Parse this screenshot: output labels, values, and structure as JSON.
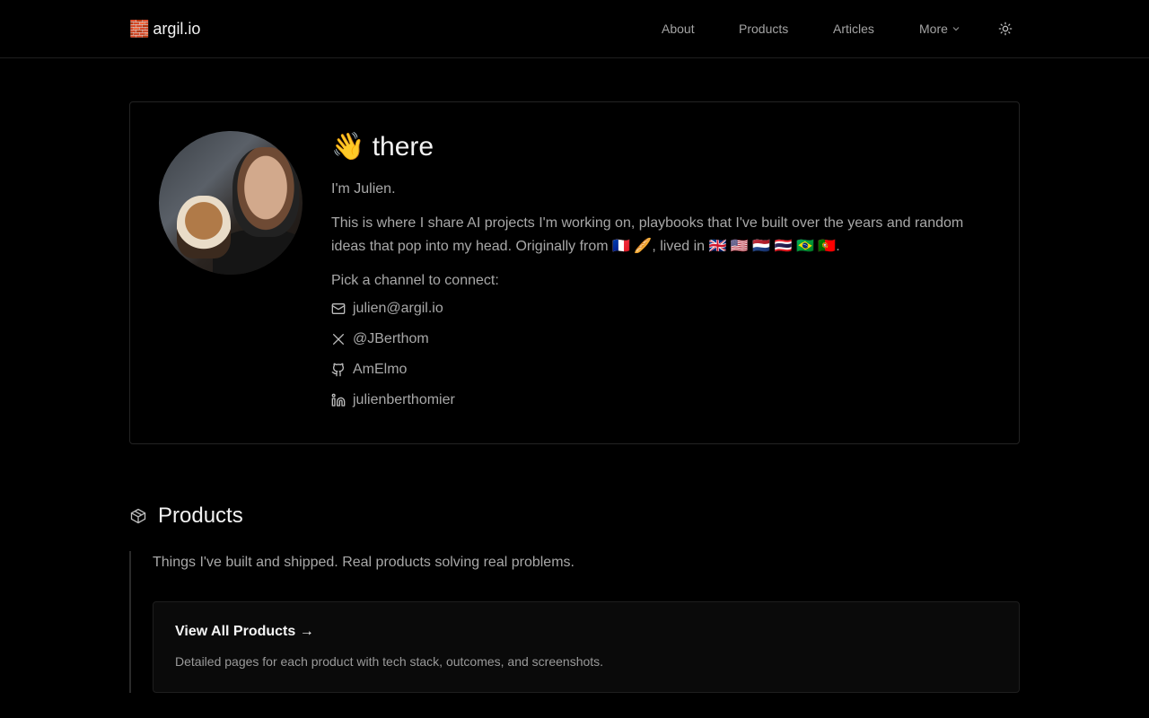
{
  "header": {
    "logo_icon": "🧱",
    "logo_text": "argil.io",
    "nav": [
      {
        "label": "About"
      },
      {
        "label": "Products"
      },
      {
        "label": "Articles"
      },
      {
        "label": "More"
      }
    ],
    "theme_icon": "sun-icon"
  },
  "intro": {
    "greeting": "👋 there",
    "im": "I'm Julien.",
    "description": "This is where I share AI projects I'm working on, playbooks that I've built over the years and random ideas that pop into my head. Originally from 🇫🇷 🥖, lived in 🇬🇧 🇺🇸 🇳🇱 🇹🇭 🇧🇷 🇵🇹.",
    "pick_channel": "Pick a channel to connect:",
    "channels": [
      {
        "icon": "mail-icon",
        "label": "julien@argil.io"
      },
      {
        "icon": "x-icon",
        "label": "@JBerthom"
      },
      {
        "icon": "github-icon",
        "label": "AmElmo"
      },
      {
        "icon": "linkedin-icon",
        "label": "julienberthomier"
      }
    ]
  },
  "products": {
    "icon": "box-icon",
    "title": "Products",
    "description": "Things I've built and shipped. Real products solving real problems.",
    "card_title": "View All Products →",
    "card_subtitle": "Detailed pages for each product with tech stack, outcomes, and screenshots."
  },
  "colors": {
    "background": "#000000",
    "text_primary": "#f2f2f2",
    "text_secondary": "#a8a8a8",
    "border": "#232323"
  }
}
